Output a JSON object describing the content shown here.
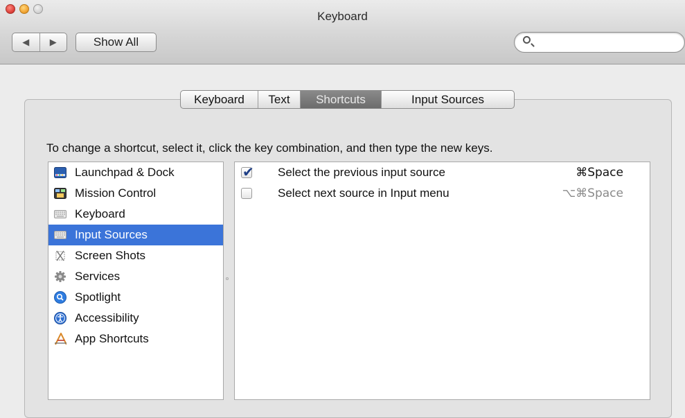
{
  "window": {
    "title": "Keyboard"
  },
  "toolbar": {
    "back_icon": "◀",
    "forward_icon": "▶",
    "show_all_label": "Show All",
    "search_value": ""
  },
  "tabs": [
    {
      "label": "Keyboard",
      "active": false
    },
    {
      "label": "Text",
      "active": false
    },
    {
      "label": "Shortcuts",
      "active": true
    },
    {
      "label": "Input Sources",
      "active": false
    }
  ],
  "instruction": "To change a shortcut, select it, click the key combination, and then type the new keys.",
  "categories": [
    {
      "label": "Launchpad & Dock",
      "icon": "launchpad-dock-icon",
      "selected": false
    },
    {
      "label": "Mission Control",
      "icon": "mission-control-icon",
      "selected": false
    },
    {
      "label": "Keyboard",
      "icon": "keyboard-icon",
      "selected": false
    },
    {
      "label": "Input Sources",
      "icon": "input-sources-icon",
      "selected": true
    },
    {
      "label": "Screen Shots",
      "icon": "screen-shots-icon",
      "selected": false
    },
    {
      "label": "Services",
      "icon": "services-gear-icon",
      "selected": false
    },
    {
      "label": "Spotlight",
      "icon": "spotlight-icon",
      "selected": false
    },
    {
      "label": "Accessibility",
      "icon": "accessibility-icon",
      "selected": false
    },
    {
      "label": "App Shortcuts",
      "icon": "app-shortcuts-icon",
      "selected": false
    }
  ],
  "shortcuts": [
    {
      "description": "Select the previous input source",
      "keys": "⌘Space",
      "checked": true,
      "enabled": true
    },
    {
      "description": "Select next source in Input menu",
      "keys": "⌥⌘Space",
      "checked": false,
      "enabled": false
    }
  ],
  "colors": {
    "selection": "#3b74d9",
    "active_tab": "#7a7a7a",
    "check": "#1f3f86"
  }
}
